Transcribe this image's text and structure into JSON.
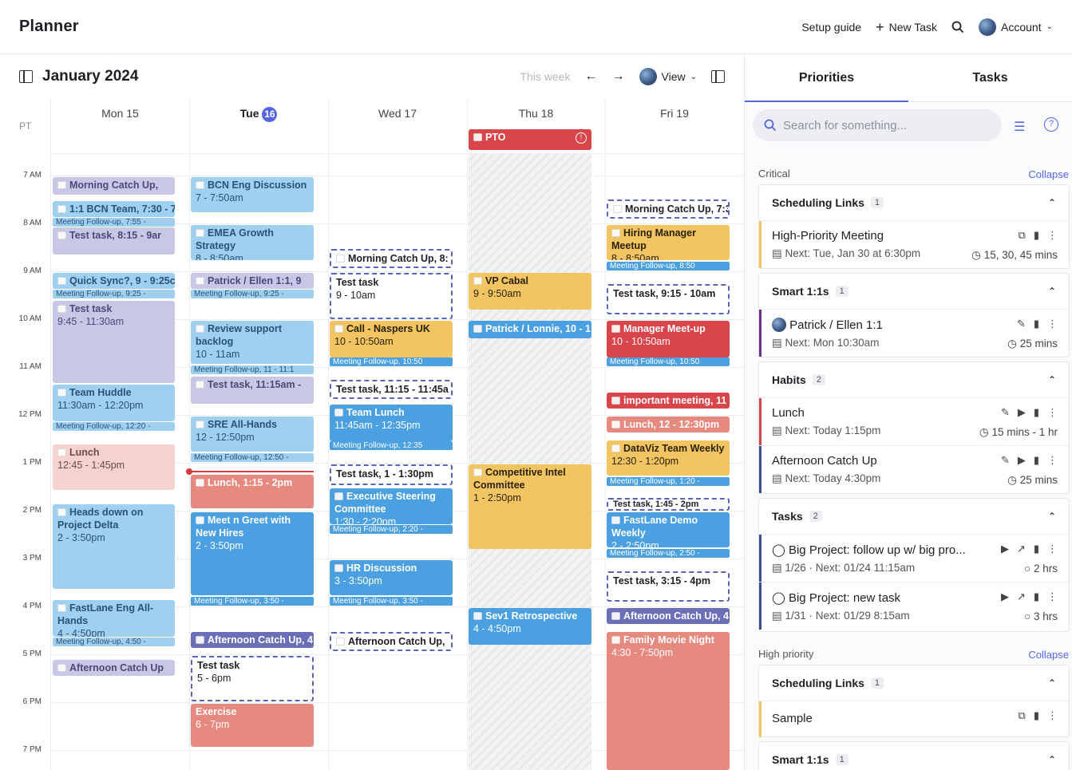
{
  "app": {
    "title": "Planner"
  },
  "topnav": {
    "setup": "Setup guide",
    "new_task": "New Task",
    "account": "Account"
  },
  "calendar": {
    "title": "January 2024",
    "this_week": "This week",
    "view": "View",
    "tz": "PT",
    "days": [
      {
        "label": "Mon 15"
      },
      {
        "label": "Tue",
        "num": "16"
      },
      {
        "label": "Wed 17"
      },
      {
        "label": "Thu 18"
      },
      {
        "label": "Fri 19"
      }
    ],
    "hours": [
      "7 AM",
      "8 AM",
      "9 AM",
      "10 AM",
      "11 AM",
      "12 PM",
      "1 PM",
      "2 PM",
      "3 PM",
      "4 PM",
      "5 PM",
      "6 PM",
      "7 PM"
    ]
  },
  "events": {
    "mon": {
      "e1": "Morning Catch Up,",
      "e2": "1:1 BCN Team, 7:30 - 7:",
      "e3": "Meeting Follow-up, 7:55 -",
      "e4": "Test task, 8:15 - 9ar",
      "e5": "Quick Sync?, 9 - 9:25c",
      "e6": "Meeting Follow-up, 9:25 -",
      "e7t": "Test task",
      "e7s": "9:45 - 11:30am",
      "e8t": "Team Huddle",
      "e8s": "11:30am - 12:20pm",
      "e9": "Meeting Follow-up, 12:20 -",
      "e10t": "Lunch",
      "e10s": "12:45 - 1:45pm",
      "e11t": "Heads down on Project Delta",
      "e11s": "2 - 3:50pm",
      "e12t": "FastLane Eng All-Hands",
      "e12s": "4 - 4:50pm",
      "e13": "Meeting Follow-up, 4:50 -",
      "e14": "Afternoon Catch Up"
    },
    "tue": {
      "e1t": "BCN Eng Discussion",
      "e1s": "7 - 7:50am",
      "e2t": "EMEA Growth Strategy",
      "e2s": "8 - 8:50am",
      "e3": "Patrick / Ellen 1:1, 9",
      "e4": "Meeting Follow-up, 9:25 -",
      "e5t": "Review support backlog",
      "e5s": "10 - 11am",
      "e6": "Meeting Follow-up, 11 - 11:1",
      "e7": "Test task, 11:15am -",
      "e8t": "SRE All-Hands",
      "e8s": "12 - 12:50pm",
      "e9": "Meeting Follow-up, 12:50 -",
      "e10": "Lunch, 1:15 - 2pm",
      "e11t": "Meet n Greet with New Hires",
      "e11s": "2 - 3:50pm",
      "e12": "Meeting Follow-up, 3:50 -",
      "e13": "Afternoon Catch Up, 4",
      "e14t": "Test task",
      "e14s": "5 - 6pm",
      "e15t": "Exercise",
      "e15s": "6 - 7pm"
    },
    "wed": {
      "e1": "Morning Catch Up, 8:",
      "e2t": "Test task",
      "e2s": "9 - 10am",
      "e3t": "Call - Naspers UK",
      "e3s": "10 - 10:50am",
      "e4": "Meeting Follow-up, 10:50",
      "e5": "Test task, 11:15 - 11:45a",
      "e6t": "Team Lunch",
      "e6s": "11:45am - 12:35pm",
      "e7": "Meeting Follow-up, 12:35",
      "e8": "Test task, 1 - 1:30pm",
      "e9t": "Executive Steering Committee",
      "e9s": "1:30 - 2:20pm",
      "e10": "Meeting Follow-up, 2:20 -",
      "e11t": "HR Discussion",
      "e11s": "3 - 3:50pm",
      "e12": "Meeting Follow-up, 3:50 -",
      "e13": "Afternoon Catch Up,"
    },
    "thu": {
      "e1": "PTO",
      "e2t": "VP Cabal",
      "e2s": "9 - 9:50am",
      "e3": "Patrick / Lonnie, 10 - 1",
      "e4t": "Competitive Intel Committee",
      "e4s": "1 - 2:50pm",
      "e5t": "Sev1 Retrospective",
      "e5s": "4 - 4:50pm"
    },
    "fri": {
      "e1": "Morning Catch Up, 7:3",
      "e2t": "Hiring Manager Meetup",
      "e2s": "8 - 8:50am",
      "e3": "Meeting Follow-up, 8:50",
      "e4": "Test task, 9:15 - 10am",
      "e5t": "Manager Meet-up",
      "e5s": "10 - 10:50am",
      "e6": "Meeting Follow-up, 10:50",
      "e7": "important meeting, 11",
      "e8": "Lunch, 12 - 12:30pm",
      "e9t": "DataViz Team Weekly",
      "e9s": "12:30 - 1:20pm",
      "e10": "Meeting Follow-up, 1:20 -",
      "e11": "Test task, 1:45 - 2pm",
      "e12t": "FastLane Demo Weekly",
      "e12s": "2 - 2:50pm",
      "e13": "Meeting Follow-up, 2:50 -",
      "e14": "Test task, 3:15 - 4pm",
      "e15": "Afternoon Catch Up, 4",
      "e16t": "Family Movie Night",
      "e16s": "4:30 - 7:50pm"
    }
  },
  "panel": {
    "tab_priorities": "Priorities",
    "tab_tasks": "Tasks",
    "search_placeholder": "Search for something...",
    "critical": "Critical",
    "high": "High priority",
    "collapse": "Collapse",
    "sched": {
      "label": "Scheduling Links",
      "count": "1",
      "item": "High-Priority Meeting",
      "next": "Next: Tue, Jan 30 at 6:30pm",
      "dur": "15, 30, 45 mins"
    },
    "smart": {
      "label": "Smart 1:1s",
      "count": "1",
      "item": "Patrick / Ellen 1:1",
      "next": "Next: Mon 10:30am",
      "dur": "25 mins"
    },
    "habits": {
      "label": "Habits",
      "count": "2",
      "i1": "Lunch",
      "n1": "Next: Today 1:15pm",
      "d1": "15 mins - 1 hr",
      "i2": "Afternoon Catch Up",
      "n2": "Next: Today 4:30pm",
      "d2": "25 mins"
    },
    "tasks": {
      "label": "Tasks",
      "count": "2",
      "i1": "Big Project: follow up w/ big pro...",
      "n1": "1/26 · Next: 01/24 11:15am",
      "d1": "2 hrs",
      "i2": "Big Project: new task",
      "n2": "1/31 · Next: 01/29 8:15am",
      "d2": "3 hrs"
    },
    "sched2": {
      "label": "Scheduling Links",
      "count": "1",
      "item": "Sample"
    },
    "smart2": {
      "label": "Smart 1:1s",
      "count": "1"
    }
  },
  "colors": {
    "accent": "#5465e8",
    "blue": "#4aa0e0",
    "yellow": "#f2c462",
    "red": "#d8454a",
    "purple": "#6b6fb8"
  }
}
